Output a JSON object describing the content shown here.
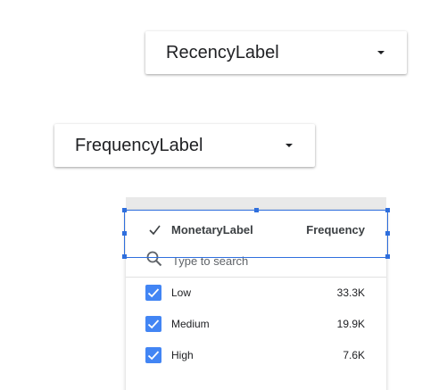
{
  "recency_dropdown": {
    "label": "RecencyLabel"
  },
  "frequency_dropdown": {
    "label": "FrequencyLabel"
  },
  "filter_control": {
    "title": "MonetaryLabel",
    "metric": "Frequency",
    "search": {
      "placeholder": "Type to search",
      "value": ""
    },
    "items": [
      {
        "label": "Low",
        "value": "33.3K",
        "checked": true
      },
      {
        "label": "Medium",
        "value": "19.9K",
        "checked": true
      },
      {
        "label": "High",
        "value": "7.6K",
        "checked": true
      }
    ]
  },
  "colors": {
    "checkbox": "#4285f4",
    "selection": "#2f6fdd"
  }
}
